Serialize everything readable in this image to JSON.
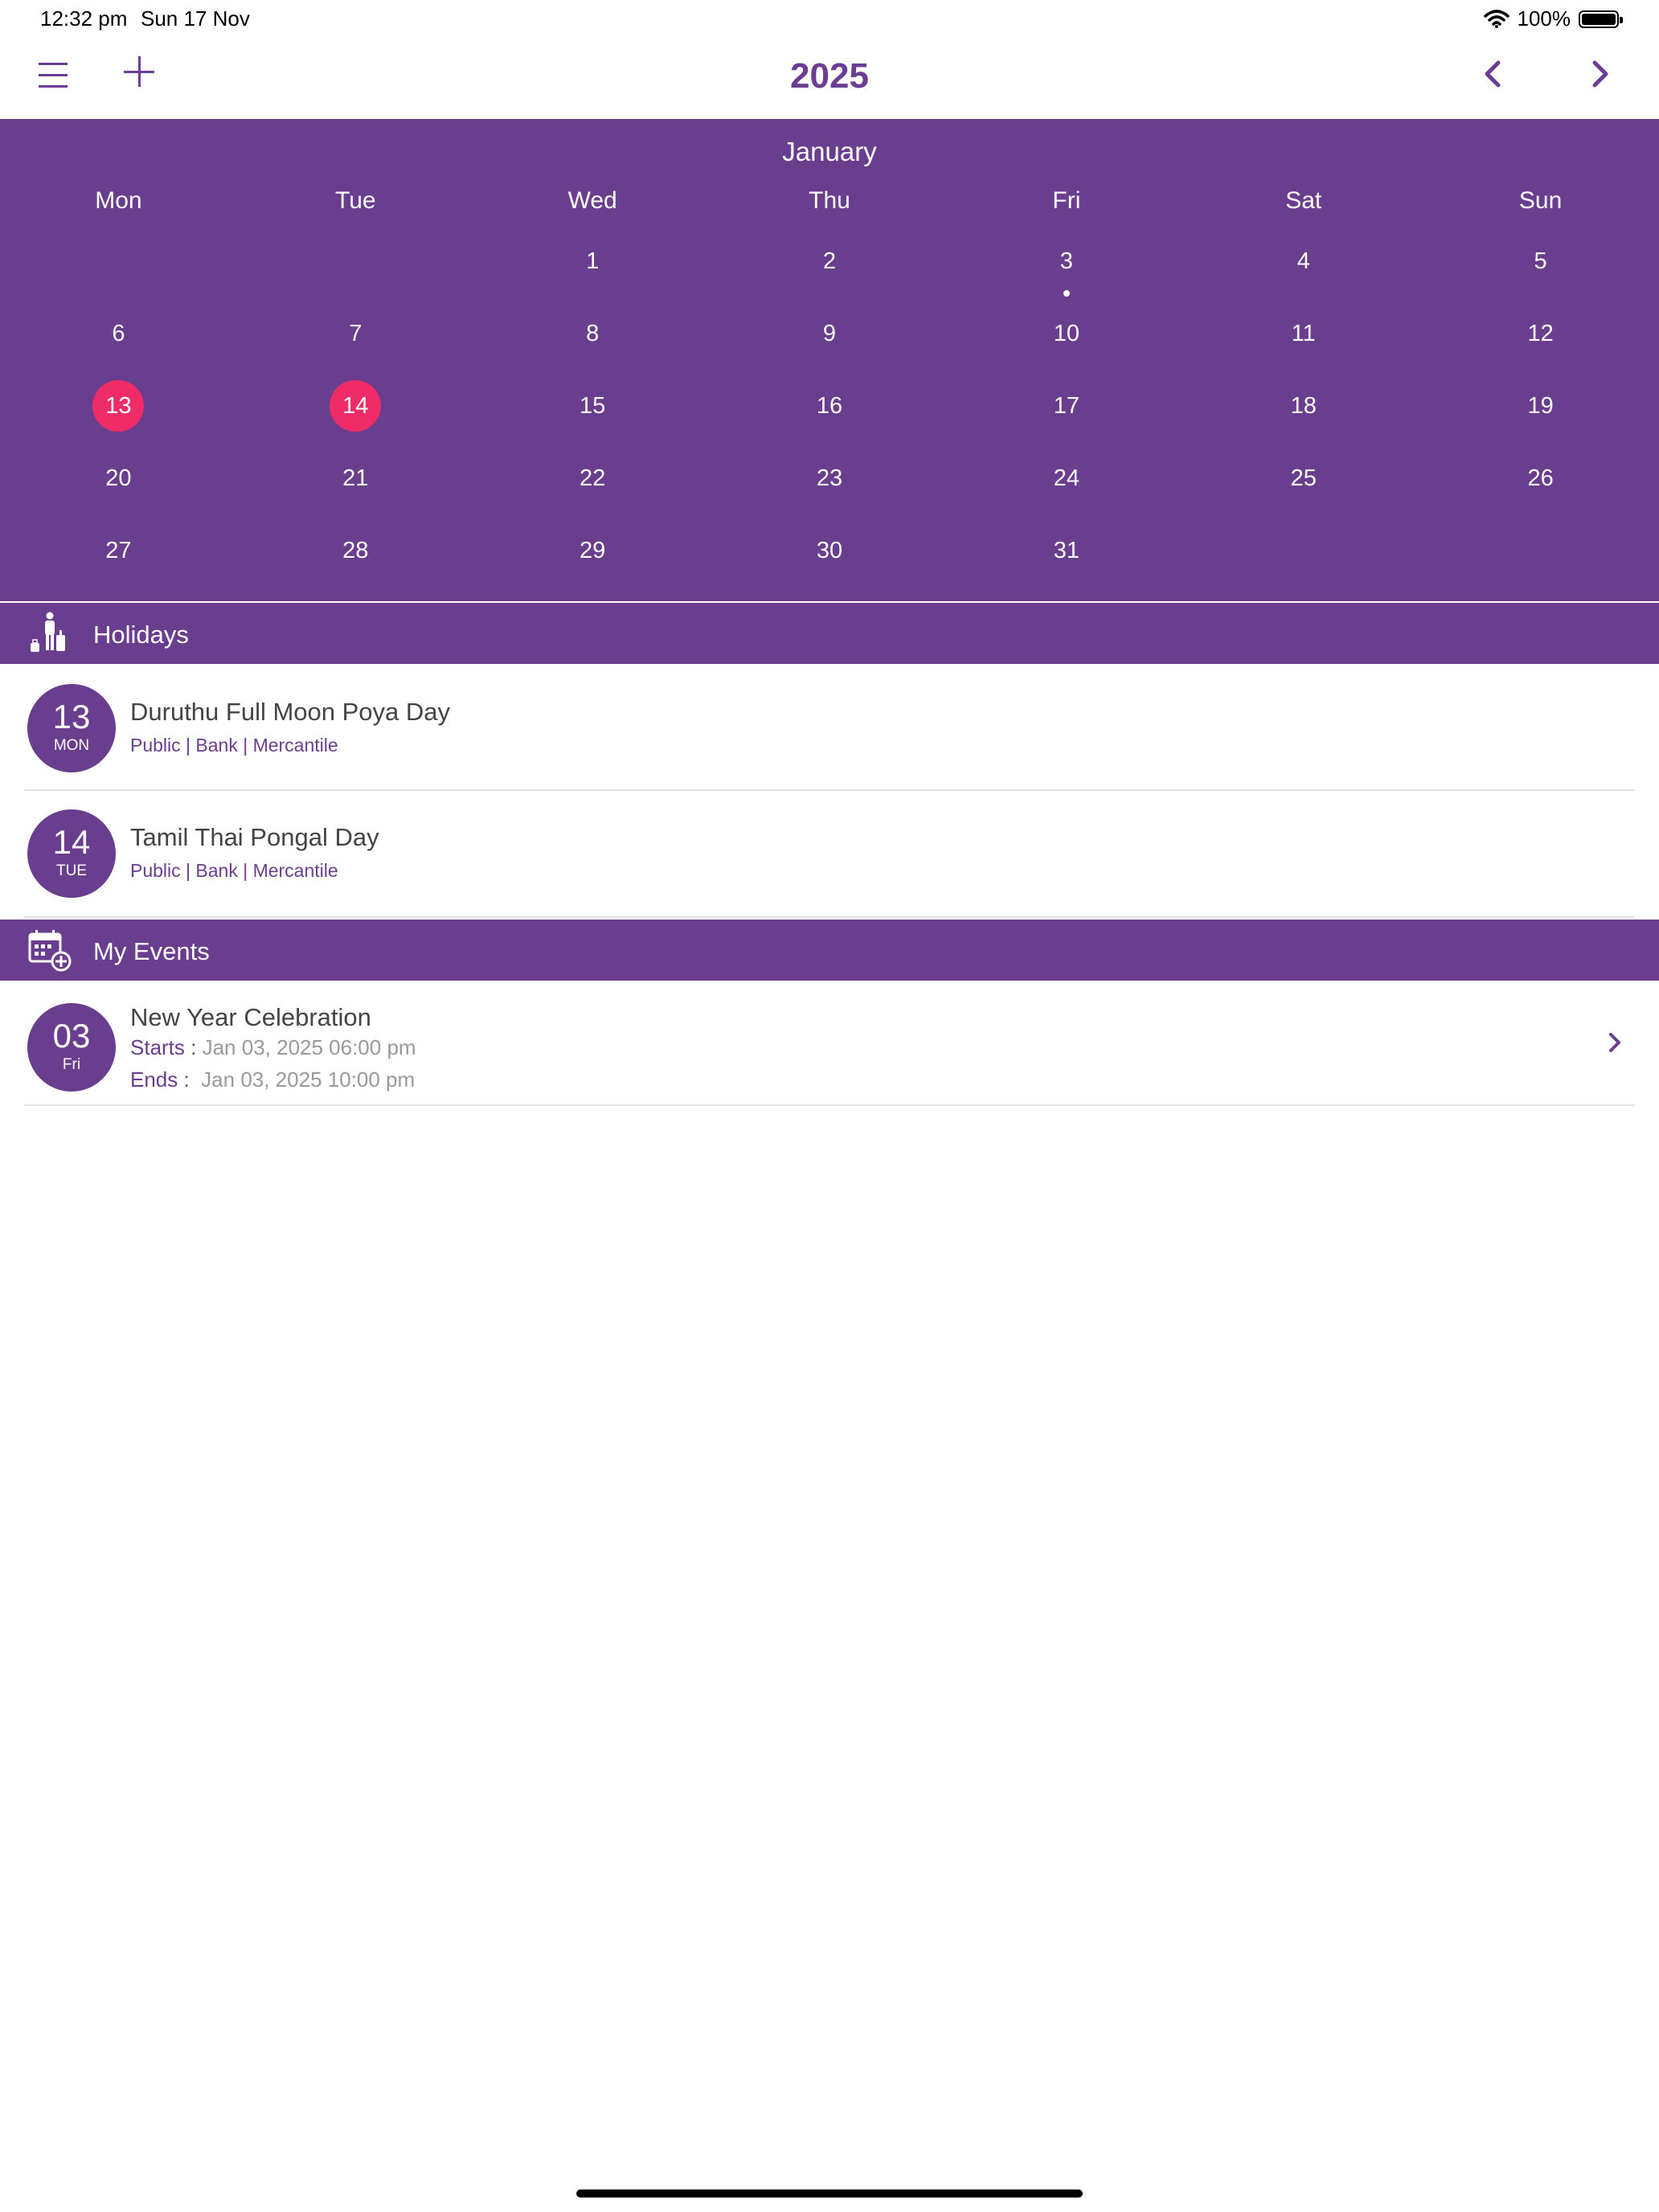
{
  "status_bar": {
    "time": "12:32 pm",
    "date": "Sun 17 Nov",
    "battery": "100%"
  },
  "nav": {
    "year": "2025"
  },
  "calendar": {
    "month": "January",
    "weekdays": [
      "Mon",
      "Tue",
      "Wed",
      "Thu",
      "Fri",
      "Sat",
      "Sun"
    ],
    "days": [
      "1",
      "2",
      "3",
      "4",
      "5",
      "6",
      "7",
      "8",
      "9",
      "10",
      "11",
      "12",
      "13",
      "14",
      "15",
      "16",
      "17",
      "18",
      "19",
      "20",
      "21",
      "22",
      "23",
      "24",
      "25",
      "26",
      "27",
      "28",
      "29",
      "30",
      "31"
    ],
    "highlighted_days": [
      "13",
      "14"
    ],
    "event_dot_days": [
      "3"
    ]
  },
  "holidays": {
    "header": "Holidays",
    "items": [
      {
        "day": "13",
        "weekday": "MON",
        "name": "Duruthu Full Moon Poya Day",
        "types": "Public | Bank | Mercantile"
      },
      {
        "day": "14",
        "weekday": "TUE",
        "name": "Tamil Thai Pongal Day",
        "types": "Public | Bank | Mercantile"
      }
    ]
  },
  "events": {
    "header": "My Events",
    "items": [
      {
        "day": "03",
        "weekday": "Fri",
        "name": "New Year Celebration",
        "starts_label": "Starts :",
        "starts": "Jan 03, 2025 06:00 pm",
        "ends_label": "Ends :",
        "ends": "Jan 03, 2025 10:00 pm"
      }
    ]
  },
  "colors": {
    "primary": "#693e8f",
    "highlight": "#f02c68"
  },
  "icons": [
    "hamburger-menu-icon",
    "plus-icon",
    "chevron-left-icon",
    "chevron-right-icon",
    "traveler-luggage-icon",
    "calendar-add-icon",
    "wifi-icon",
    "battery-icon"
  ]
}
